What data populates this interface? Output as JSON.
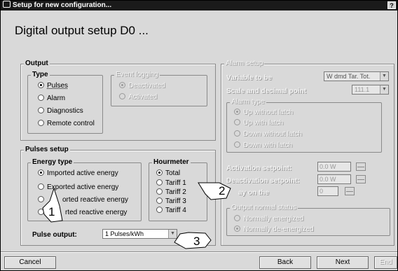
{
  "window": {
    "title": "Setup for new configuration...",
    "help_label": "?"
  },
  "heading": "Digital output setup D0 ...",
  "output": {
    "title": "Output",
    "type": {
      "title": "Type",
      "options": [
        "Pulses",
        "Alarm",
        "Diagnostics",
        "Remote control"
      ],
      "selected": "Pulses"
    },
    "event_logging": {
      "title": "Event logging",
      "options": [
        "Deactivated",
        "Activated"
      ],
      "selected": "Deactivated"
    }
  },
  "pulses_setup": {
    "title": "Pulses setup",
    "energy_type": {
      "title": "Energy type",
      "options": [
        "Imported active energy",
        "Exported active energy",
        "Imported reactive energy",
        "Exported reactive energy"
      ],
      "shown_labels": [
        "Imported active energy",
        "Exported active energy",
        "orted reactive energy",
        "rted reactive energy"
      ],
      "selected": "Imported active energy"
    },
    "hourmeter": {
      "title": "Hourmeter",
      "options": [
        "Total",
        "Tariff 1",
        "Tariff 2",
        "Tariff 3",
        "Tariff 4"
      ],
      "selected": "Total"
    },
    "pulse_output": {
      "label": "Pulse output:",
      "value": "1 Pulses/kWh"
    }
  },
  "alarm_setup": {
    "title": "Alarm setup",
    "variable_label": "Variable to be",
    "variable_value": "W dmd Tar. Tot.",
    "scale_label": "Scale and decimal point",
    "scale_value": "111.1",
    "alarm_type": {
      "title": "Alarm type",
      "options": [
        "Up without latch",
        "Up with latch",
        "Down without latch",
        "Down with latch"
      ],
      "selected": "Up without latch"
    },
    "activation_label": "Activation setpoint:",
    "activation_value": "0.0 W",
    "deactivation_label": "Deactivation setpoint:",
    "deactivation_value": "0.0 W",
    "delay_label": "ay on the",
    "delay_value": "0",
    "normal_status": {
      "title": "Output normal status",
      "options": [
        "Normally energized",
        "Normally de-energized"
      ],
      "selected": "Normally de-energized"
    }
  },
  "buttons": {
    "cancel": "Cancel",
    "back": "Back",
    "next": "Next",
    "end": "End"
  },
  "callouts": [
    "1",
    "2",
    "3"
  ]
}
